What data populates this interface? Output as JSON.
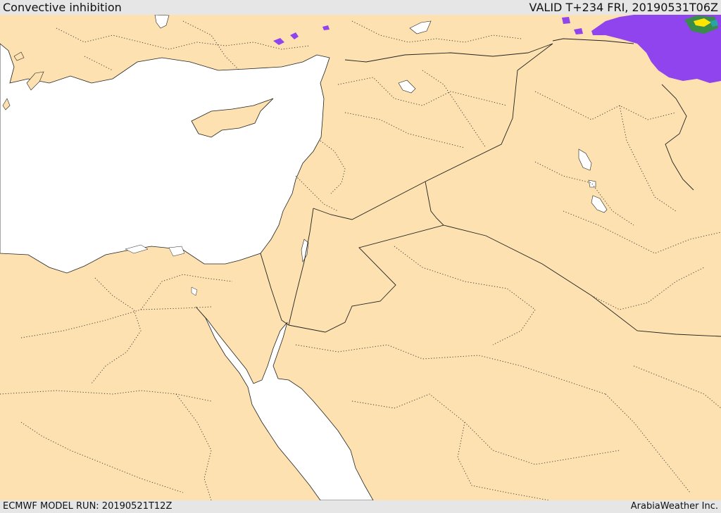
{
  "header": {
    "title": "Convective inhibition",
    "valid": "VALID T+234 FRI, 20190531T06Z"
  },
  "footer": {
    "model_run": "ECMWF MODEL RUN: 20190521T12Z",
    "credit": "ArabiaWeather Inc."
  },
  "colors": {
    "land": "#fde1b0",
    "sea": "#ffffff",
    "border": "#222222",
    "cin_light": "#8f44ee",
    "cin_medium": "#3a8c4a",
    "cin_high": "#ffe600"
  }
}
